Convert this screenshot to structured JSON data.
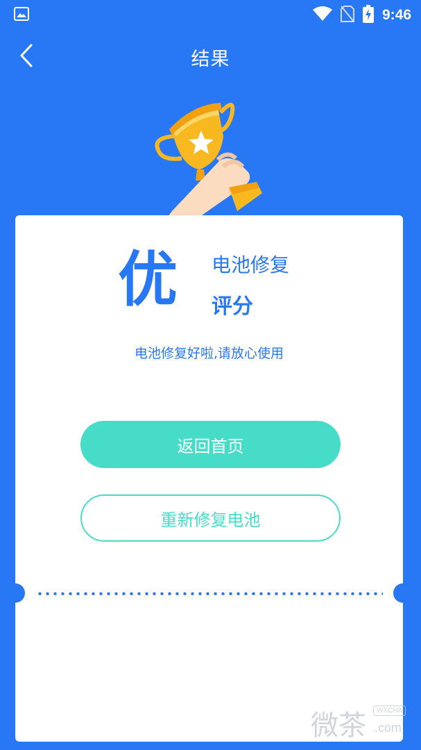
{
  "status_bar": {
    "time": "9:46",
    "icons": [
      "image-icon",
      "wifi-icon",
      "no-sim-icon",
      "battery-charging-icon"
    ]
  },
  "nav": {
    "title": "结果",
    "back_icon": "back-arrow-icon"
  },
  "result": {
    "grade": "优",
    "label_top": "电池修复",
    "label_bottom": "评分",
    "message": "电池修复好啦,请放心使用"
  },
  "buttons": {
    "home": "返回首页",
    "repair_again": "重新修复电池"
  },
  "watermark": {
    "main": "微茶",
    "tag": "WXCHA",
    "domain": ".com"
  },
  "colors": {
    "background": "#2878f5",
    "primary_text": "#2878f5",
    "accent": "#46dcc8",
    "trophy": "#f7b820",
    "card": "#ffffff"
  }
}
